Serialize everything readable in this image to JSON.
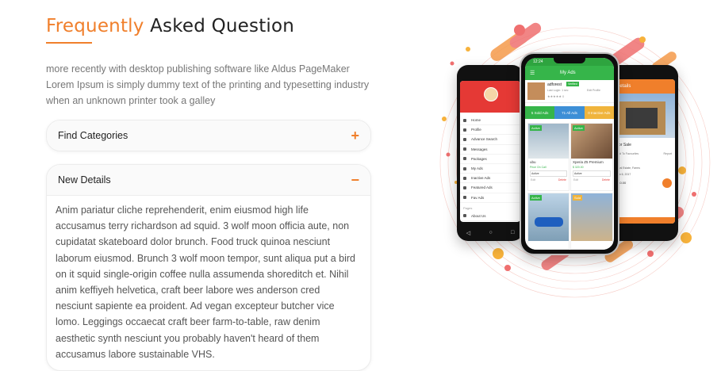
{
  "faq": {
    "title_accent": "Frequently",
    "title_rest": "Asked Question",
    "intro": "more recently with desktop publishing software like Aldus PageMaker Lorem Ipsum is simply dummy text of the printing and typesetting industry when an unknown printer took a galley",
    "items": [
      {
        "label": "Find Categories",
        "toggle": "+"
      },
      {
        "label": "New Details",
        "toggle": "−",
        "body": "Anim pariatur cliche reprehenderit, enim eiusmod high life accusamus terry richardson ad squid. 3 wolf moon officia aute, non cupidatat skateboard dolor brunch. Food truck quinoa nesciunt laborum eiusmod. Brunch 3 wolf moon tempor, sunt aliqua put a bird on it squid single-origin coffee nulla assumenda shoreditch et. Nihil anim keffiyeh helvetica, craft beer labore wes anderson cred nesciunt sapiente ea proident. Ad vegan excepteur butcher vice lomo. Leggings occaecat craft beer farm-to-table, raw denim aesthetic synth nesciunt you probably haven't heard of them accusamus labore sustainable VHS."
      }
    ]
  },
  "mockup": {
    "center": {
      "time": "12:24",
      "header": "My Ads",
      "user": "adforest",
      "badge": "Verified",
      "last_login": "Last Login: 1 sec",
      "edit_profile": "Edit Profile",
      "rating_count": "0",
      "tabs": [
        "5 Sold Ads",
        "71 All Ads",
        "0 Inactive Ads"
      ],
      "cards": [
        {
          "tag": "Active",
          "name": "ubu",
          "price": "Price On Call",
          "status": "Active",
          "edit": "Edit",
          "del": "Delete"
        },
        {
          "tag": "Active",
          "name": "Xperia Z5 Premium",
          "price": "$ 320.00",
          "status": "Active",
          "edit": "Edit",
          "del": "Delete"
        },
        {
          "tag": "Active"
        },
        {
          "tag": "Sold"
        }
      ]
    },
    "left": {
      "menu": [
        "Home",
        "Profile",
        "Advance Search",
        "Messages",
        "Packages",
        "My Ads",
        "Inactive Ads",
        "Featured Ads",
        "Fav Ads"
      ],
      "section": "Pages",
      "about": "About Us"
    },
    "right": {
      "header": "Details",
      "label": "For Sale",
      "favorites": "Add To Favourites",
      "report": "Report",
      "location": "Real Estate, Farms",
      "date": "Jan 6, 2017",
      "price": "440.00"
    }
  },
  "colors": {
    "accent": "#f07f2b",
    "green": "#36b54a",
    "blue": "#3d8fd6",
    "amber": "#f0b43c",
    "red": "#e53935"
  }
}
